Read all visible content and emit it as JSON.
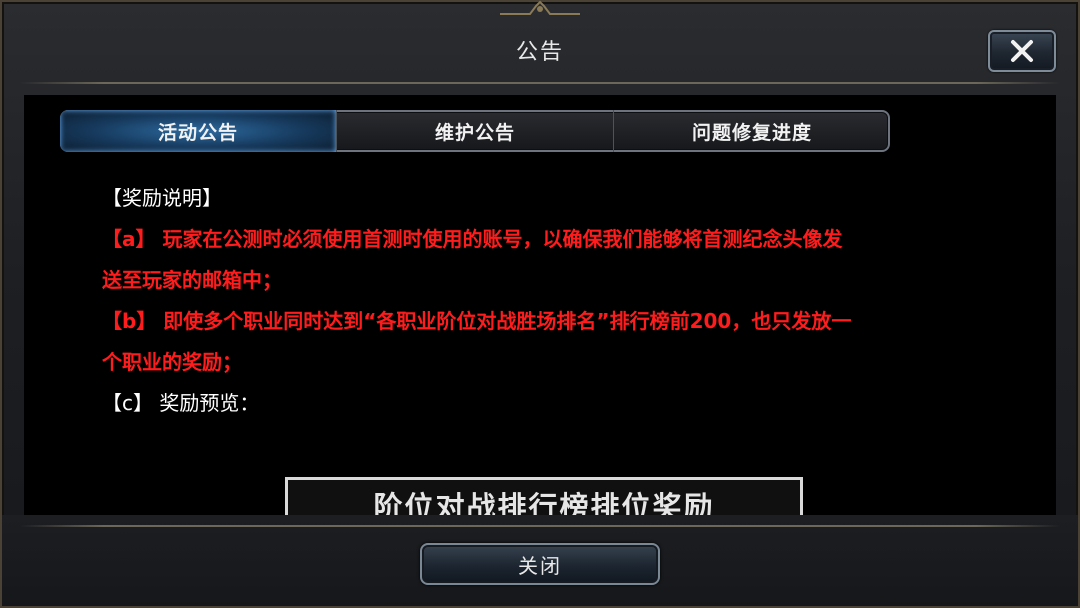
{
  "header": {
    "title": "公告"
  },
  "close_icon": "close-x-icon",
  "tabs": [
    {
      "label": "活动公告",
      "active": true
    },
    {
      "label": "维护公告",
      "active": false
    },
    {
      "label": "问题修复进度",
      "active": false
    }
  ],
  "content": {
    "heading": "【奖励说明】",
    "item_a_line1": "【a】 玩家在公测时必须使用首测时使用的账号，以确保我们能够将首测纪念头像发",
    "item_a_line2": "送至玩家的邮箱中；",
    "item_b_line1": "【b】 即使多个职业同时达到“各职业阶位对战胜场排名”排行榜前200，也只发放一",
    "item_b_line2": "个职业的奖励；",
    "item_c": "【c】 奖励预览：",
    "preview_title": "阶位对战排行榜排位奖励"
  },
  "footer": {
    "close_label": "关闭"
  },
  "colors": {
    "highlight_red": "#ff1c1c",
    "active_tab_blue": "#2d6aa0",
    "panel_black": "#000000"
  }
}
